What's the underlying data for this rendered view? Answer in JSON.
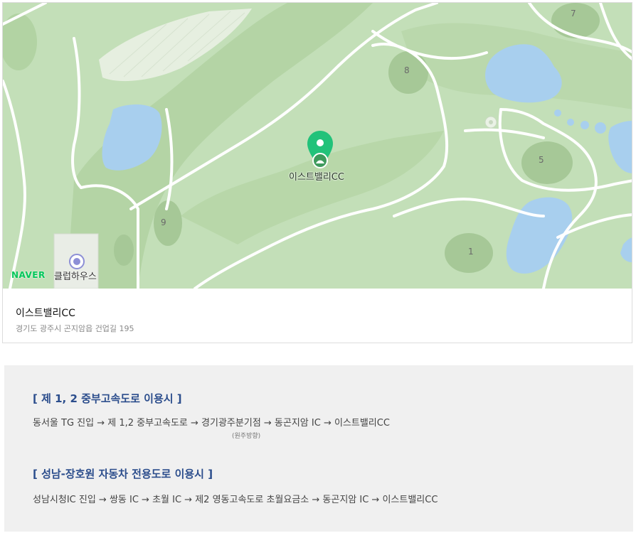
{
  "map": {
    "brand_logo": "NAVER",
    "marker_label": "이스트밸리CC",
    "poi_label": "클럽하우스",
    "hole_labels": [
      "7",
      "8",
      "5",
      "9",
      "1"
    ],
    "colors": {
      "land": "#c3dfb8",
      "fairway": "#b2d3a3",
      "dark": "#a6c897",
      "water": "#a8cfee",
      "road": "#ffffff",
      "marker": "#22c27a",
      "logo": "#03c75a",
      "poi": "#8d8fd6"
    }
  },
  "place": {
    "name": "이스트밸리CC",
    "address": "경기도 광주시 곤지암읍 건업길 195"
  },
  "directions": {
    "routes": [
      {
        "title": "[ 제 1, 2 중부고속도로 이용시 ]",
        "path": "동서울 TG 진입 → 제 1,2 중부고속도로  → 경기광주분기점 → 동곤지암 IC → 이스트밸리CC",
        "note": "(원주방향)"
      },
      {
        "title": "[ 성남-장호원 자동차 전용도로 이용시 ]",
        "path": "성남시청IC 진입 → 쌍동 IC  → 초월 IC → 제2 영동고속도로 초월요금소 → 동곤지암 IC → 이스트밸리CC"
      }
    ],
    "colors": {
      "title": "#2b4d8c",
      "text": "#444444",
      "background": "#f0f0f0"
    }
  }
}
